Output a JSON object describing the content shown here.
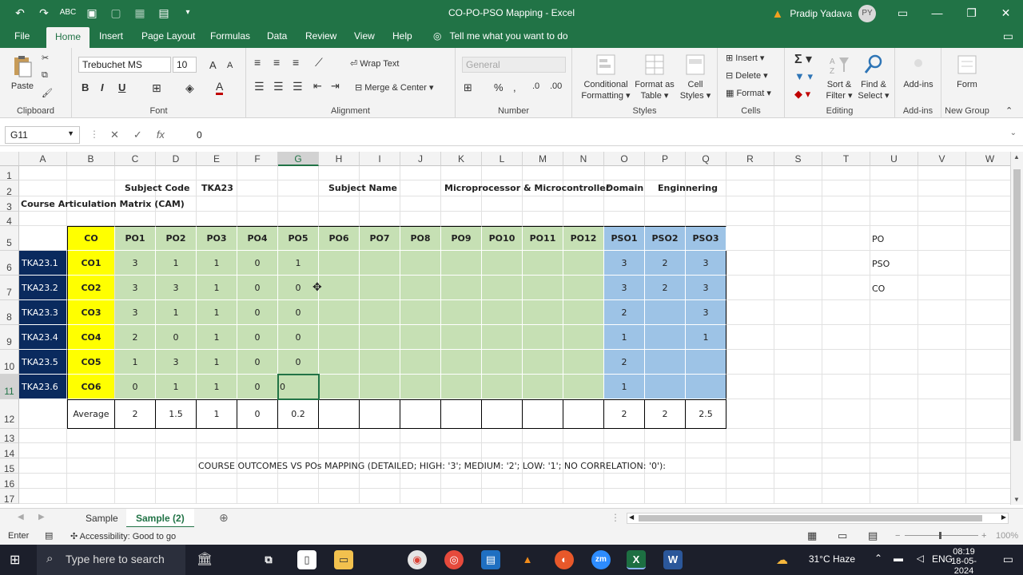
{
  "window": {
    "title": "CO-PO-PSO Mapping  -  Excel",
    "user_name": "Pradip Yadava",
    "user_initials": "PY"
  },
  "tabs": [
    "File",
    "Home",
    "Insert",
    "Page Layout",
    "Formulas",
    "Data",
    "Review",
    "View",
    "Help"
  ],
  "tell_me": "Tell me what you want to do",
  "ribbon": {
    "clipboard": {
      "paste": "Paste",
      "label": "Clipboard"
    },
    "font": {
      "name": "Trebuchet MS",
      "size": "10",
      "label": "Font",
      "bold": "B",
      "italic": "I",
      "underline": "U"
    },
    "alignment": {
      "wrap": "Wrap Text",
      "merge": "Merge & Center",
      "label": "Alignment"
    },
    "number": {
      "format": "General",
      "label": "Number"
    },
    "styles": {
      "conditional": "Conditional",
      "conditional2": "Formatting",
      "format_table": "Format as",
      "format_table2": "Table",
      "cell_styles": "Cell",
      "cell_styles2": "Styles",
      "label": "Styles"
    },
    "cells": {
      "insert": "Insert",
      "delete": "Delete",
      "format": "Format",
      "label": "Cells"
    },
    "editing": {
      "sort": "Sort &",
      "sort2": "Filter",
      "find": "Find &",
      "find2": "Select",
      "label": "Editing"
    },
    "addins": {
      "btn": "Add-ins",
      "label": "Add-ins"
    },
    "newgroup": {
      "btn": "Form",
      "label": "New Group"
    }
  },
  "formula_bar": {
    "name_box": "G11",
    "value": "0"
  },
  "columns": [
    "A",
    "B",
    "C",
    "D",
    "E",
    "F",
    "G",
    "H",
    "I",
    "J",
    "K",
    "L",
    "M",
    "N",
    "O",
    "P",
    "Q",
    "R",
    "S",
    "T",
    "U",
    "V",
    "W"
  ],
  "rows": [
    "1",
    "2",
    "3",
    "4",
    "5",
    "6",
    "7",
    "8",
    "9",
    "10",
    "11",
    "12",
    "13",
    "14",
    "15",
    "16",
    "17"
  ],
  "sheet": {
    "subject_code_label": "Subject Code",
    "subject_code": "TKA23",
    "subject_name_label": "Subject Name",
    "subject_name": "Microprocessor & Microcontroller",
    "domain_label": "Domain",
    "domain": "Enginnering",
    "cam_title": "Course Articulation Matrix (CAM)",
    "header": [
      "CO",
      "PO1",
      "PO2",
      "PO3",
      "PO4",
      "PO5",
      "PO6",
      "PO7",
      "PO8",
      "PO9",
      "PO10",
      "PO11",
      "PO12",
      "PSO1",
      "PSO2",
      "PSO3"
    ],
    "table": [
      {
        "code": "TKA23.1",
        "co": "CO1",
        "po": [
          "3",
          "1",
          "1",
          "0",
          "1",
          "",
          "",
          "",
          "",
          "",
          "",
          ""
        ],
        "pso": [
          "3",
          "2",
          "3"
        ]
      },
      {
        "code": "TKA23.2",
        "co": "CO2",
        "po": [
          "3",
          "3",
          "1",
          "0",
          "0",
          "",
          "",
          "",
          "",
          "",
          "",
          ""
        ],
        "pso": [
          "3",
          "2",
          "3"
        ]
      },
      {
        "code": "TKA23.3",
        "co": "CO3",
        "po": [
          "3",
          "1",
          "1",
          "0",
          "0",
          "",
          "",
          "",
          "",
          "",
          "",
          ""
        ],
        "pso": [
          "2",
          "",
          "3"
        ]
      },
      {
        "code": "TKA23.4",
        "co": "CO4",
        "po": [
          "2",
          "0",
          "1",
          "0",
          "0",
          "",
          "",
          "",
          "",
          "",
          "",
          ""
        ],
        "pso": [
          "1",
          "",
          "1"
        ]
      },
      {
        "code": "TKA23.5",
        "co": "CO5",
        "po": [
          "1",
          "3",
          "1",
          "0",
          "0",
          "",
          "",
          "",
          "",
          "",
          "",
          ""
        ],
        "pso": [
          "2",
          "",
          ""
        ]
      },
      {
        "code": "TKA23.6",
        "co": "CO6",
        "po": [
          "0",
          "1",
          "1",
          "0",
          "0",
          "",
          "",
          "",
          "",
          "",
          "",
          ""
        ],
        "pso": [
          "1",
          "",
          ""
        ]
      }
    ],
    "average_label": "Average",
    "average": [
      "2",
      "1.5",
      "1",
      "0",
      "0.2",
      "",
      "",
      "",
      "",
      "",
      "",
      "",
      "2",
      "2",
      "2.5"
    ],
    "side_labels": [
      "PO",
      "PSO",
      "CO"
    ],
    "footnote": "COURSE OUTCOMES VS POs MAPPING (DETAILED; HIGH: '3'; MEDIUM: '2'; LOW: '1'; NO CORRELATION: '0'):"
  },
  "sheet_tabs": [
    "Sample",
    "Sample (2)"
  ],
  "status": {
    "mode": "Enter",
    "accessibility": "Accessibility: Good to go",
    "zoom": "100%"
  },
  "taskbar": {
    "search": "Type here to search",
    "weather": "31°C  Haze",
    "lang": "ENG",
    "time": "08:19",
    "date": "18-05-2024"
  },
  "colors": {
    "accent": "#217346",
    "yellow": "#ffff00",
    "green": "#c6e0b4",
    "blue": "#9dc3e6",
    "navy": "#0a2a5e"
  }
}
